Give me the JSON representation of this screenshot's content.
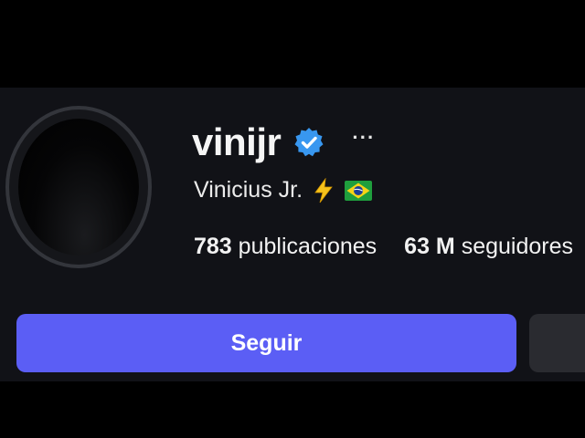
{
  "profile": {
    "username": "vinijr",
    "full_name": "Vinicius Jr.",
    "more_label": "···",
    "verified": true,
    "verified_color": "#3897f0",
    "emojis": [
      "bolt-icon",
      "brazil-flag-icon"
    ]
  },
  "stats": [
    {
      "value": "783",
      "label": "publicaciones"
    },
    {
      "value": "63 M",
      "label": "seguidores"
    }
  ],
  "actions": {
    "follow_label": "Seguir",
    "follow_color": "#5b5ef5"
  },
  "colors": {
    "background": "#111217",
    "text": "#f5f5f5"
  }
}
